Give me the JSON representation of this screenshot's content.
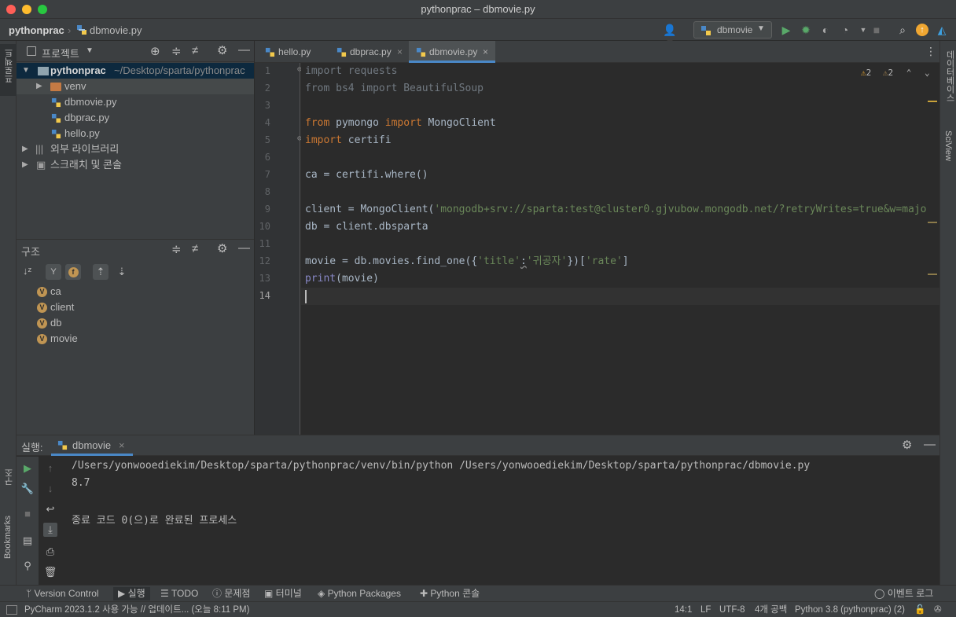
{
  "window": {
    "title": "pythonprac – dbmovie.py"
  },
  "nav": {
    "project": "pythonprac",
    "file": "dbmovie.py",
    "run_config": "dbmovie"
  },
  "project_panel": {
    "title": "프로젝트",
    "root": "pythonprac",
    "root_path": "~/Desktop/sparta/pythonprac",
    "items": [
      "venv",
      "dbmovie.py",
      "dbprac.py",
      "hello.py",
      "외부 라이브러리",
      "스크래치 및 콘솔"
    ]
  },
  "structure_panel": {
    "title": "구조",
    "vars": [
      "ca",
      "client",
      "db",
      "movie"
    ],
    "badge": "V"
  },
  "tabs": [
    "hello.py",
    "dbprac.py",
    "dbmovie.py"
  ],
  "editor": {
    "warnings_a": "2",
    "warnings_b": "2",
    "line_numbers": [
      "1",
      "2",
      "3",
      "4",
      "5",
      "6",
      "7",
      "8",
      "9",
      "10",
      "11",
      "12",
      "13",
      "14"
    ],
    "code": {
      "l1": "import requests",
      "l2": "from bs4 import BeautifulSoup",
      "l4_a": "from",
      "l4_b": " pymongo ",
      "l4_c": "import",
      "l4_d": " MongoClient",
      "l5_a": "import",
      "l5_b": " certifi",
      "l7": "ca = certifi.where()",
      "l9_a": "client = MongoClient(",
      "l9_b": "'mongodb+srv://sparta:test@cluster0.gjvubow.mongodb.net/?retryWrites=true&w=majo",
      "l10": "db = client.dbsparta",
      "l12_a": "movie = db.movies.find_one({",
      "l12_b": "'title'",
      "l12_c": ":",
      "l12_d": "'귀공자'",
      "l12_e": "})[",
      "l12_f": "'rate'",
      "l12_g": "]",
      "l13_a": "print",
      "l13_b": "(movie)"
    }
  },
  "run_panel": {
    "label": "실행:",
    "tab": "dbmovie",
    "cmd": "/Users/yonwooediekim/Desktop/sparta/pythonprac/venv/bin/python /Users/yonwooediekim/Desktop/sparta/pythonprac/dbmovie.py",
    "result": "8.7",
    "exit": "종료 코드 0(으)로 완료된 프로세스"
  },
  "left_strip": {
    "project": "프로젝트",
    "structure": "구조",
    "bookmarks": "Bookmarks"
  },
  "right_strip": {
    "database": "데이터베이스",
    "sciview": "SciView"
  },
  "tool_windows": {
    "vc": "Version Control",
    "run": "실행",
    "todo": "TODO",
    "problems": "문제점",
    "terminal": "터미널",
    "packages": "Python Packages",
    "console": "Python 콘솔",
    "events": "이벤트 로그"
  },
  "status": {
    "message": "PyCharm 2023.1.2 사용 가능 // 업데이트... (오늘 8:11 PM)",
    "position": "14:1",
    "lf": "LF",
    "encoding": "UTF-8",
    "indent": "4개 공백",
    "interpreter": "Python 3.8 (pythonprac) (2)"
  },
  "colors": {
    "keyword": "#cc7832",
    "string": "#6a8759",
    "builtin": "#8888c6",
    "text": "#a9b7c6",
    "accent": "#4a88c7"
  }
}
